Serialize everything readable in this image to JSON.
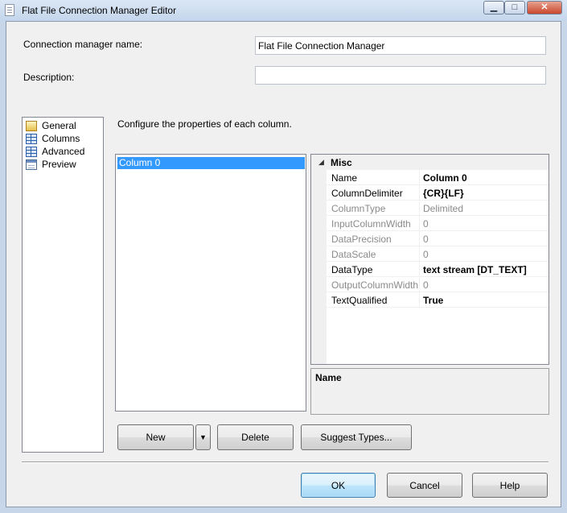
{
  "window": {
    "title": "Flat File Connection Manager Editor",
    "min_glyph": "▁",
    "max_glyph": "□",
    "close_glyph": "✕"
  },
  "form": {
    "name_label": "Connection manager name:",
    "name_value": "Flat File Connection Manager",
    "description_label": "Description:",
    "description_value": ""
  },
  "nav": {
    "items": [
      {
        "label": "General",
        "icon": "general-icon"
      },
      {
        "label": "Columns",
        "icon": "columns-icon"
      },
      {
        "label": "Advanced",
        "icon": "advanced-icon"
      },
      {
        "label": "Preview",
        "icon": "preview-icon"
      }
    ]
  },
  "main": {
    "instruction": "Configure the properties of each column.",
    "columns": [
      "Column 0"
    ],
    "selected_column": "Column 0"
  },
  "properties": {
    "category": "Misc",
    "collapse_glyph": "◢",
    "rows": [
      {
        "name": "Name",
        "value": "Column 0",
        "enabled": true,
        "bold": true
      },
      {
        "name": "ColumnDelimiter",
        "value": "{CR}{LF}",
        "enabled": true,
        "bold": true
      },
      {
        "name": "ColumnType",
        "value": "Delimited",
        "enabled": false,
        "bold": false
      },
      {
        "name": "InputColumnWidth",
        "value": "0",
        "enabled": false,
        "bold": false
      },
      {
        "name": "DataPrecision",
        "value": "0",
        "enabled": false,
        "bold": false
      },
      {
        "name": "DataScale",
        "value": "0",
        "enabled": false,
        "bold": false
      },
      {
        "name": "DataType",
        "value": "text stream [DT_TEXT]",
        "enabled": true,
        "bold": true
      },
      {
        "name": "OutputColumnWidth",
        "value": "0",
        "enabled": false,
        "bold": false
      },
      {
        "name": "TextQualified",
        "value": "True",
        "enabled": true,
        "bold": true
      }
    ],
    "description_title": "Name"
  },
  "buttons": {
    "new": "New",
    "new_dropdown": "▼",
    "delete": "Delete",
    "suggest": "Suggest Types...",
    "ok": "OK",
    "cancel": "Cancel",
    "help": "Help"
  }
}
